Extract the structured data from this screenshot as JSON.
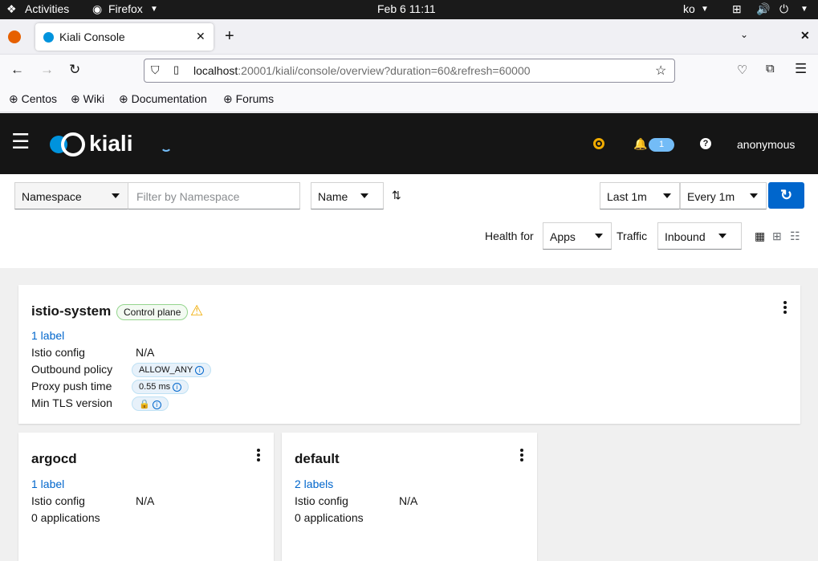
{
  "system": {
    "activities": "Activities",
    "app": "Firefox",
    "clock": "Feb 6  11:11",
    "lang": "ko"
  },
  "browser": {
    "tab_title": "Kiali Console",
    "url_host": "localhost",
    "url_path": ":20001/kiali/console/overview?duration=60&refresh=60000",
    "bookmarks": [
      "Centos",
      "Wiki",
      "Documentation",
      "Forums"
    ]
  },
  "kiali": {
    "logo_text": "kiali",
    "notif_count": "1",
    "user": "anonymous"
  },
  "filters": {
    "filter_type": "Namespace",
    "filter_placeholder": "Filter by Namespace",
    "sort": "Name",
    "duration": "Last 1m",
    "refresh": "Every 1m",
    "health_for_label": "Health for",
    "health_for": "Apps",
    "traffic_label": "Traffic",
    "traffic": "Inbound"
  },
  "cards": {
    "istio": {
      "name": "istio-system",
      "badge": "Control plane",
      "labels": "1 label",
      "rows": [
        {
          "label": "Istio config",
          "value": "N/A"
        },
        {
          "label": "Outbound policy",
          "value": "ALLOW_ANY"
        },
        {
          "label": "Proxy push time",
          "value": "0.55 ms"
        },
        {
          "label": "Min TLS version",
          "value": ""
        }
      ]
    },
    "argocd": {
      "name": "argocd",
      "labels": "1 label",
      "config_label": "Istio config",
      "config_value": "N/A",
      "apps": "0 applications"
    },
    "default": {
      "name": "default",
      "labels": "2 labels",
      "config_label": "Istio config",
      "config_value": "N/A",
      "apps": "0 applications"
    }
  },
  "colors": {
    "masthead": "#151515",
    "link": "#0066cc",
    "warning": "#f0ab00",
    "logo": "#0093dd"
  }
}
